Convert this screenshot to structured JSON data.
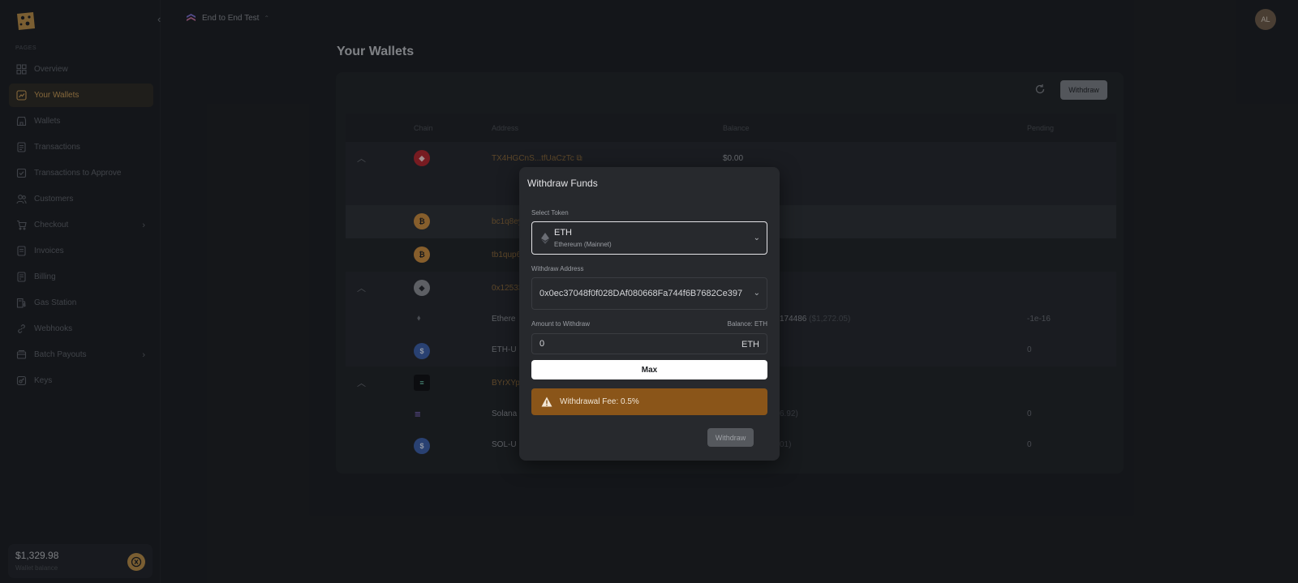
{
  "app": {
    "org_name": "End to End Test",
    "user_initials": "AL"
  },
  "sidebar": {
    "section_label": "Pages",
    "items": [
      {
        "label": "Overview",
        "icon": "grid-icon"
      },
      {
        "label": "Your Wallets",
        "icon": "wallet-chart-icon",
        "active": true
      },
      {
        "label": "Wallets",
        "icon": "store-icon"
      },
      {
        "label": "Transactions",
        "icon": "document-icon"
      },
      {
        "label": "Transactions to Approve",
        "icon": "document-check-icon"
      },
      {
        "label": "Customers",
        "icon": "users-icon"
      },
      {
        "label": "Checkout",
        "icon": "cart-icon",
        "expandable": true
      },
      {
        "label": "Invoices",
        "icon": "invoice-icon"
      },
      {
        "label": "Billing",
        "icon": "billing-icon"
      },
      {
        "label": "Gas Station",
        "icon": "gas-pump-icon"
      },
      {
        "label": "Webhooks",
        "icon": "link-icon"
      },
      {
        "label": "Batch Payouts",
        "icon": "batch-icon",
        "expandable": true
      },
      {
        "label": "Keys",
        "icon": "key-icon"
      }
    ],
    "wallet_balance": {
      "amount": "$1,329.98",
      "label": "Wallet balance"
    }
  },
  "main": {
    "title": "Your Wallets",
    "withdraw_button": "Withdraw",
    "table": {
      "headers": [
        "Chain",
        "Address",
        "Balance",
        "Pending"
      ],
      "rows": [
        {
          "address": "TX4HGCnS...tfUaCzTc",
          "balance": "$0.00",
          "pending": ""
        },
        {
          "address": "bc1q8ey",
          "balance": "",
          "pending": ""
        },
        {
          "address": "tb1qup6",
          "balance": "",
          "pending": ""
        },
        {
          "address": "0x12533",
          "balance": "",
          "pending": ""
        },
        {
          "name": "Ethere",
          "balance": "174486",
          "balance_usd": "($1,272.05)",
          "pending": "-1e-16"
        },
        {
          "name": "ETH-U",
          "balance": "",
          "pending": "0"
        },
        {
          "address": "BYrXYpp",
          "balance": "",
          "pending": ""
        },
        {
          "name": "Solana",
          "balance_usd": "6.92)",
          "pending": "0"
        },
        {
          "name": "SOL-U",
          "balance_usd": "01)",
          "pending": "0"
        }
      ]
    }
  },
  "modal": {
    "title": "Withdraw Funds",
    "select_token_label": "Select Token",
    "token": {
      "symbol": "ETH",
      "network": "Ethereum (Mainnet)"
    },
    "withdraw_address_label": "Withdraw Address",
    "withdraw_address": "0x0ec37048f0f028DAf080668Fa744f6B7682Ce397",
    "amount_label": "Amount to Withdraw",
    "balance_hint": "Balance: ETH",
    "amount_value": "0",
    "amount_unit": "ETH",
    "max_button": "Max",
    "fee_text": "Withdrawal Fee: 0.5%",
    "withdraw_button": "Withdraw"
  },
  "colors": {
    "background": "#1b1d21",
    "accent": "#c99a54",
    "warning": "#8a5519"
  }
}
